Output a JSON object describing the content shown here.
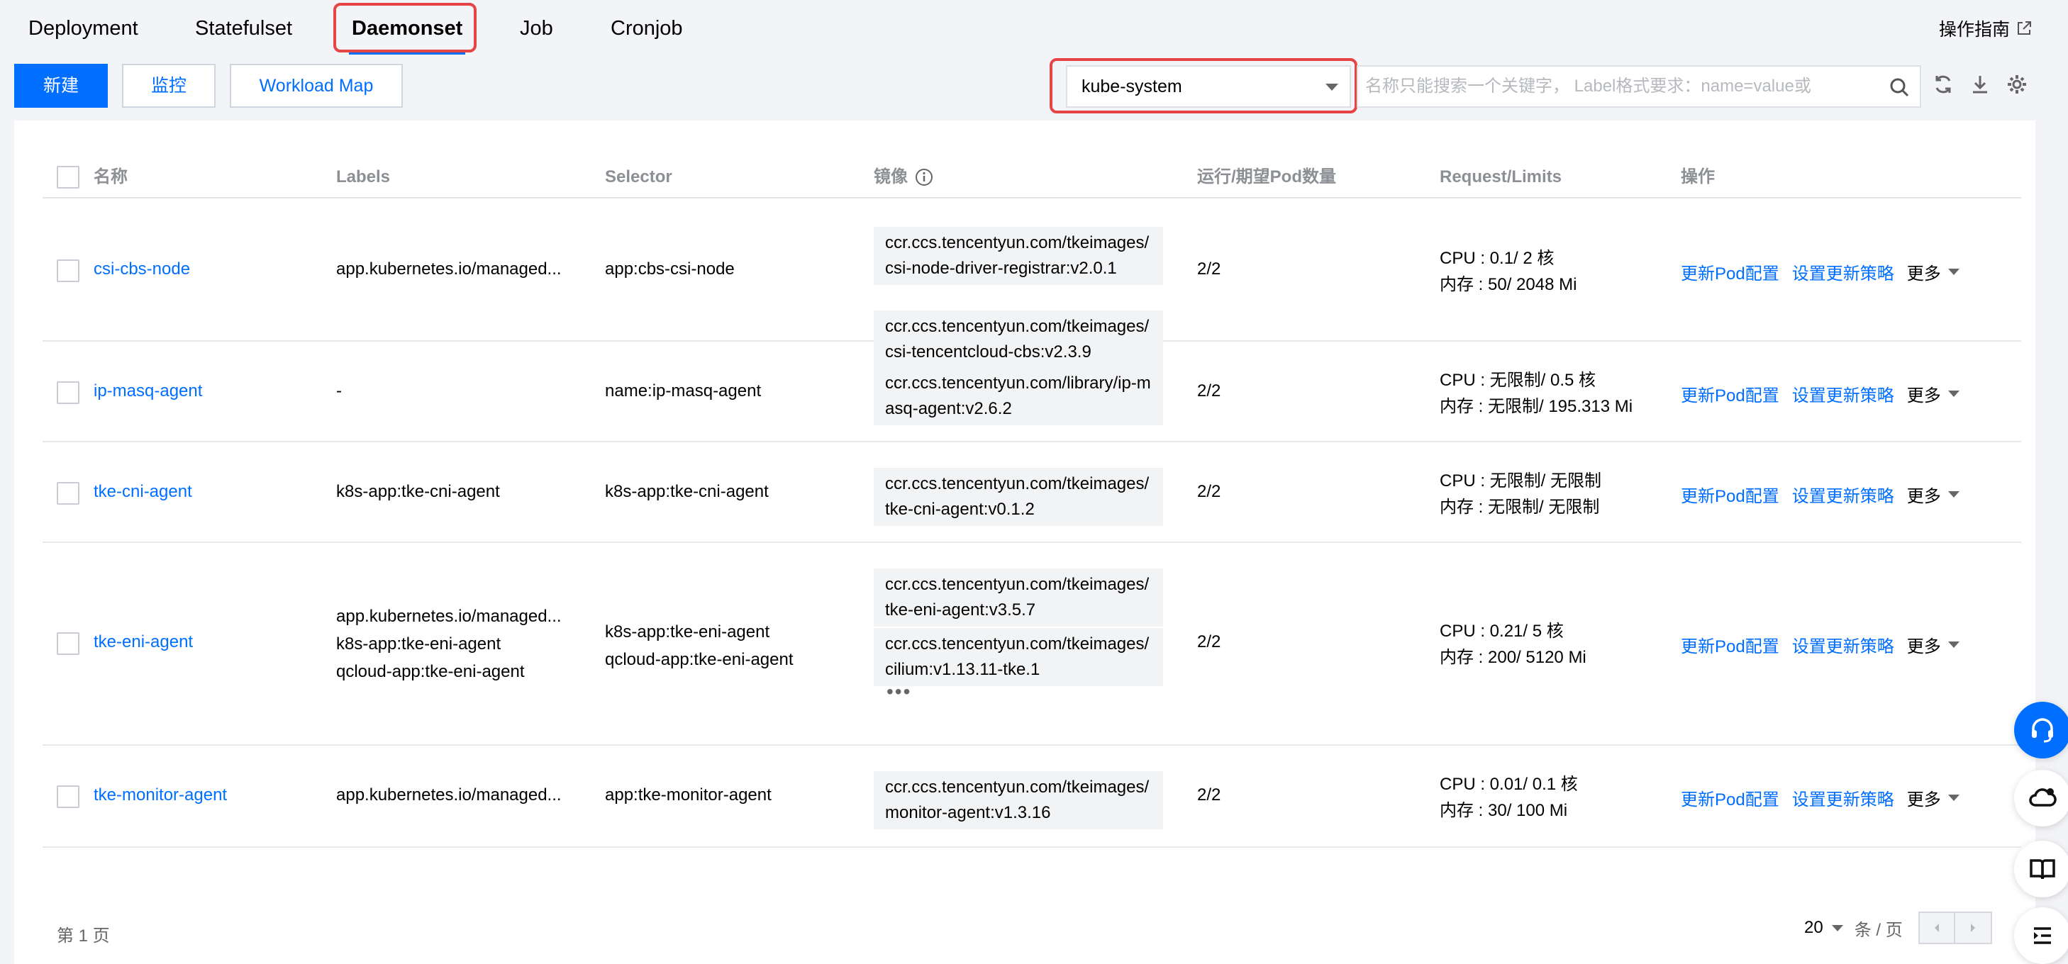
{
  "tabs": [
    {
      "label": "Deployment",
      "active": false
    },
    {
      "label": "Statefulset",
      "active": false
    },
    {
      "label": "Daemonset",
      "active": true
    },
    {
      "label": "Job",
      "active": false
    },
    {
      "label": "Cronjob",
      "active": false
    }
  ],
  "guide_label": "操作指南",
  "toolbar": {
    "create_label": "新建",
    "monitor_label": "监控",
    "workload_map_label": "Workload Map"
  },
  "namespace": {
    "value": "kube-system"
  },
  "search": {
    "placeholder": "名称只能搜索一个关键字， Label格式要求：name=value或"
  },
  "table": {
    "headers": {
      "name": "名称",
      "labels": "Labels",
      "selector": "Selector",
      "image": "镜像",
      "pods": "运行/期望Pod数量",
      "resources": "Request/Limits",
      "actions": "操作"
    },
    "rows": [
      {
        "name": "csi-cbs-node",
        "labels": [
          "app.kubernetes.io/managed..."
        ],
        "selector": [
          "app:cbs-csi-node"
        ],
        "images": [
          "ccr.ccs.tencentyun.com/tkeimages/csi-node-driver-registrar:v2.0.1",
          "ccr.ccs.tencentyun.com/tkeimages/csi-tencentcloud-cbs:v2.3.9"
        ],
        "pods": "2/2",
        "cpu": "CPU : 0.1/ 2 核",
        "mem": "内存 : 50/ 2048 Mi"
      },
      {
        "name": "ip-masq-agent",
        "labels": [
          "-"
        ],
        "selector": [
          "name:ip-masq-agent"
        ],
        "images": [
          "ccr.ccs.tencentyun.com/library/ip-masq-agent:v2.6.2"
        ],
        "pods": "2/2",
        "cpu": "CPU : 无限制/ 0.5 核",
        "mem": "内存 : 无限制/ 195.313 Mi"
      },
      {
        "name": "tke-cni-agent",
        "labels": [
          "k8s-app:tke-cni-agent"
        ],
        "selector": [
          "k8s-app:tke-cni-agent"
        ],
        "images": [
          "ccr.ccs.tencentyun.com/tkeimages/tke-cni-agent:v0.1.2"
        ],
        "pods": "2/2",
        "cpu": "CPU : 无限制/ 无限制",
        "mem": "内存 : 无限制/ 无限制"
      },
      {
        "name": "tke-eni-agent",
        "labels": [
          "app.kubernetes.io/managed...",
          "k8s-app:tke-eni-agent",
          "qcloud-app:tke-eni-agent"
        ],
        "selector": [
          "k8s-app:tke-eni-agent",
          "qcloud-app:tke-eni-agent"
        ],
        "images": [
          "ccr.ccs.tencentyun.com/tkeimages/tke-eni-agent:v3.5.7",
          "ccr.ccs.tencentyun.com/tkeimages/cilium:v1.13.11-tke.1"
        ],
        "more_images": "•••",
        "pods": "2/2",
        "cpu": "CPU : 0.21/ 5 核",
        "mem": "内存 : 200/ 5120 Mi"
      },
      {
        "name": "tke-monitor-agent",
        "labels": [
          "app.kubernetes.io/managed..."
        ],
        "selector": [
          "app:tke-monitor-agent"
        ],
        "images": [
          "ccr.ccs.tencentyun.com/tkeimages/monitor-agent:v1.3.16"
        ],
        "pods": "2/2",
        "cpu": "CPU : 0.01/ 0.1 核",
        "mem": "内存 : 30/ 100 Mi"
      }
    ],
    "actions": {
      "update_pod": "更新Pod配置",
      "update_strategy": "设置更新策略",
      "more": "更多"
    }
  },
  "footer": {
    "page_label": "第 1 页",
    "page_size": "20",
    "per_page_label": "条 / 页"
  },
  "colors": {
    "accent": "#006eff",
    "highlight": "#e54545"
  }
}
